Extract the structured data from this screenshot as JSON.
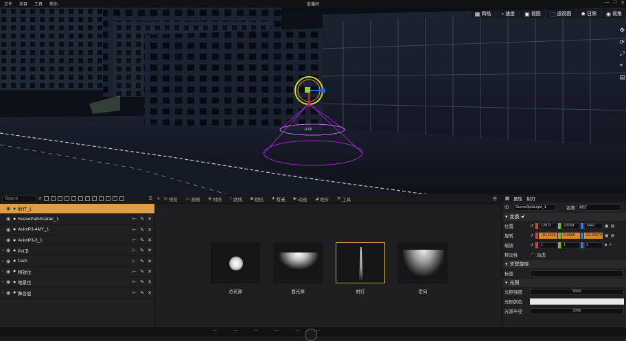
{
  "titlebar": {
    "menu": [
      "文件",
      "项目",
      "工具",
      "帮助"
    ],
    "title": "直播间",
    "controls": [
      "—",
      "□",
      "✕"
    ]
  },
  "viewport": {
    "toolbar": [
      {
        "icon": "grid-icon",
        "label": "网格"
      },
      {
        "icon": "gauge-icon",
        "label": "速度"
      },
      {
        "icon": "view-icon",
        "label": "视图"
      },
      {
        "icon": "perspective-icon",
        "label": "透视图"
      },
      {
        "icon": "sun-icon",
        "label": "日照"
      },
      {
        "icon": "eye-icon",
        "label": "视角"
      }
    ],
    "measure_label": "-3.00"
  },
  "outliner": {
    "search_placeholder": "Search",
    "items": [
      {
        "label": "射灯_1",
        "selected": true,
        "has_arrow": false,
        "tools": false
      },
      {
        "label": "ScenePathScatter_1",
        "selected": false,
        "has_arrow": false,
        "tools": true
      },
      {
        "label": "AnimP3-4MY_1",
        "selected": false,
        "has_arrow": false,
        "tools": true
      },
      {
        "label": "AnimP3-3_1",
        "selected": false,
        "has_arrow": false,
        "tools": true
      },
      {
        "label": "Pol卫",
        "selected": false,
        "has_arrow": true,
        "tools": true
      },
      {
        "label": "Cam",
        "selected": false,
        "has_arrow": true,
        "tools": true
      },
      {
        "label": "特效位",
        "selected": false,
        "has_arrow": true,
        "tools": true
      },
      {
        "label": "地景位",
        "selected": false,
        "has_arrow": true,
        "tools": true
      },
      {
        "label": "舞台层",
        "selected": false,
        "has_arrow": true,
        "tools": true
      }
    ]
  },
  "assets": {
    "tabs": [
      {
        "label": "预览",
        "active": false
      },
      {
        "label": "画刷",
        "active": false
      },
      {
        "label": "材质",
        "active": false
      },
      {
        "label": "路线",
        "active": false
      },
      {
        "label": "相机",
        "active": false
      },
      {
        "label": "灯光",
        "active": true
      },
      {
        "label": "动画",
        "active": false
      },
      {
        "label": "地形",
        "active": false
      },
      {
        "label": "工具",
        "active": false
      }
    ],
    "cards": [
      {
        "label": "点光源",
        "kind": "point",
        "selected": false
      },
      {
        "label": "面光源",
        "kind": "area",
        "selected": false
      },
      {
        "label": "射灯",
        "kind": "spot",
        "selected": true
      },
      {
        "label": "定向",
        "kind": "directional",
        "selected": false
      }
    ]
  },
  "props": {
    "header_tabs": [
      "属性",
      "射灯"
    ],
    "id_label": "ID",
    "id_value": "SceneSpotLight_1",
    "name_label": "名称",
    "name_value": "射灯",
    "transform_section": "变换",
    "position_label": "位置",
    "position": [
      "12973",
      "23769",
      "1442"
    ],
    "rotation_label": "旋转",
    "rotation": [
      "-10.1615",
      "0.0000",
      "23.05674"
    ],
    "scale_label": "缩放",
    "scale": [
      "1",
      "1",
      "1"
    ],
    "mobility_label": "移动性",
    "mobility_value": "动态",
    "keyframe_section": "关联旋库",
    "tag_label": "标签",
    "light_section": "光照",
    "intensity_label": "光照强度",
    "intensity_value": "5000",
    "color_label": "光照颜色",
    "radius_label": "光源半径",
    "radius_value": "1000"
  },
  "colors": {
    "selection": "#d9a24a",
    "magenta_gizmo": "#a020c8",
    "yellow_gizmo": "#d8d81a"
  }
}
